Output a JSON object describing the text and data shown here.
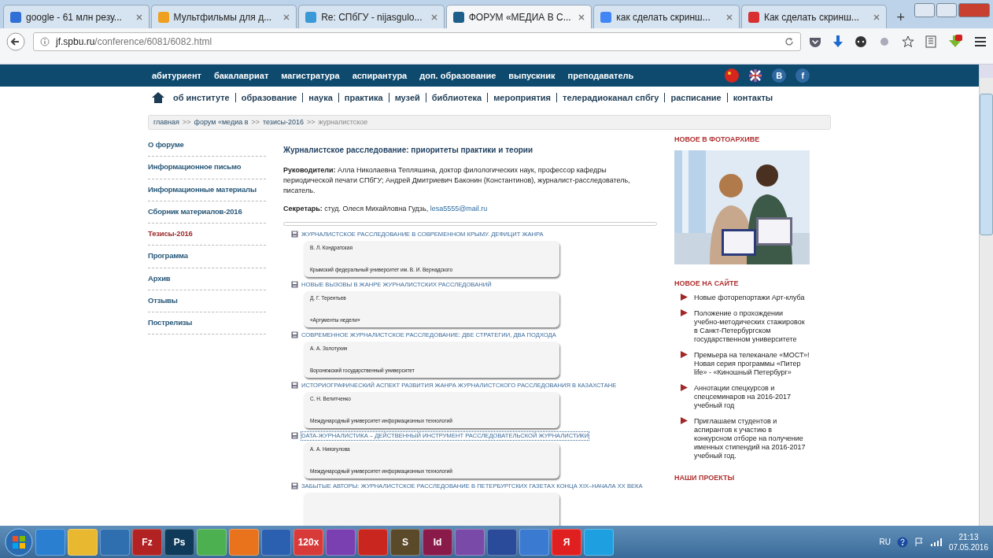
{
  "browser": {
    "tabs": [
      {
        "title": "google - 61 млн резу...",
        "selected": false,
        "color": "#2f6fd6"
      },
      {
        "title": "Мультфильмы для д...",
        "selected": false,
        "color": "#f0a020"
      },
      {
        "title": "Re: СПбГУ - nijasgulo...",
        "selected": false,
        "color": "#3a9ad8"
      },
      {
        "title": "ФОРУМ «МЕДИА В С...",
        "selected": true,
        "color": "#1d5f8a"
      },
      {
        "title": "как сделать скринш...",
        "selected": false,
        "color": "#4285f4"
      },
      {
        "title": "Как сделать скринш...",
        "selected": false,
        "color": "#d83030"
      }
    ],
    "new_tab": "+",
    "address": {
      "host": "jf.spbu.ru",
      "path": "/conference/6081/6082.html"
    }
  },
  "site": {
    "top_menu": [
      "абитуриент",
      "бакалавриат",
      "магистратура",
      "аспирантура",
      "доп. образование",
      "выпускник",
      "преподаватель"
    ],
    "social": [
      "B",
      "f"
    ],
    "nav": [
      "об институте",
      "образование",
      "наука",
      "практика",
      "музей",
      "библиотека",
      "мероприятия",
      "телерадиоканал спбгу",
      "расписание",
      "контакты"
    ],
    "breadcrumb": [
      {
        "kind": "link",
        "label": "главная"
      },
      {
        "kind": "sep",
        "label": ">>"
      },
      {
        "kind": "link",
        "label": "форум «медиа в"
      },
      {
        "kind": "sep",
        "label": ">>"
      },
      {
        "kind": "link",
        "label": "тезисы-2016"
      },
      {
        "kind": "sep",
        "label": ">>"
      },
      {
        "kind": "current",
        "label": "журналистское"
      }
    ],
    "sidebar": [
      {
        "label": "О форуме",
        "selected": false
      },
      {
        "label": "Информационное письмо",
        "selected": false
      },
      {
        "label": "Информационные материалы",
        "selected": false
      },
      {
        "label": "Сборник материалов-2016",
        "selected": false
      },
      {
        "label": "Тезисы-2016",
        "selected": true
      },
      {
        "label": "Программа",
        "selected": false
      },
      {
        "label": "Архив",
        "selected": false
      },
      {
        "label": "Отзывы",
        "selected": false
      },
      {
        "label": "Пострелизы",
        "selected": false
      }
    ],
    "article": {
      "title": "Журналистское расследование: приоритеты практики и теории",
      "leaders": "**Руководители:** Алла Николаевна Тепляшина, доктор филологических наук, профессор кафедры периодической печати СПбГУ; Андрей Дмитриевич Баконин (Константинов), журналист-расследователь, писатель.",
      "secretary": "**Секретарь:** студ. Олеся Михайловна Гудзь,",
      "email": "lesa5555@mail.ru"
    },
    "theses": [
      {
        "title": "ЖУРНАЛИСТСКОЕ РАССЛЕДОВАНИЕ В СОВРЕМЕННОМ КРЫМУ. ДЕФИЦИТ ЖАНРА",
        "author": "В. Л. Кондратская",
        "affiliation": "Крымский федеральный университет им. В. И. Вернадского",
        "focused": false
      },
      {
        "title": "НОВЫЕ ВЫЗОВЫ В ЖАНРЕ ЖУРНАЛИСТСКИХ РАССЛЕДОВАНИЙ",
        "author": "Д. Г. Терентьев",
        "affiliation": "«Аргументы недели»",
        "focused": false
      },
      {
        "title": "СОВРЕМЕННОЕ ЖУРНАЛИСТСКОЕ РАССЛЕДОВАНИЕ: ДВЕ СТРАТЕГИИ, ДВА ПОДХОДА",
        "author": "А. А. Золотухин",
        "affiliation": "Воронежский государственный университет",
        "focused": false
      },
      {
        "title": "ИСТОРИОГРАФИЧЕСКИЙ АСПЕКТ РАЗВИТИЯ ЖАНРА ЖУРНАЛИСТСКОГО РАССЛЕДОВАНИЯ В КАЗАХСТАНЕ",
        "author": "С. Н. Велитченко",
        "affiliation": "Международный университет информационных технологий",
        "focused": false
      },
      {
        "title": "DATA-ЖУРНАЛИСТИКА – ДЕЙСТВЕННЫЙ ИНСТРУМЕНТ РАССЛЕДОВАТЕЛЬСКОЙ ЖУРНАЛИСТИКИ",
        "author": "А. А. Ниязгулова",
        "affiliation": "Международный университет информационных технологий",
        "focused": true
      },
      {
        "title": "ЗАБЫТЫЕ АВТОРЫ: ЖУРНАЛИСТСКОЕ РАССЛЕДОВАНИЕ В ПЕТЕРБУРГСКИХ ГАЗЕТАХ КОНЦА XIX–НАЧАЛА XX ВЕКА",
        "focused": false
      }
    ],
    "right": {
      "photo_heading": "НОВОЕ В ФОТОАРХИВЕ",
      "photo": {
        "kind": "picture"
      },
      "news_heading": "НОВОЕ НА САЙТЕ",
      "news": [
        "Новые фоторепортажи Арт-клуба",
        "Положение о прохождении учебно-методических стажировок в Санкт-Петербургском государственном университете",
        "Премьера на телеканале «МОСТ»! Новая серия программы «Питер life» - «Киношный Петербург»",
        "Аннотации спецкурсов и спецсеминаров на 2016-2017 учебный год",
        "Приглашаем студентов и аспирантов к участию в конкурсном отборе на получение именных стипендий на 2016-2017 учебный год."
      ],
      "projects_heading": "НАШИ ПРОЕКТЫ"
    }
  },
  "taskbar": {
    "items": [
      {
        "color": "#2a7fd0"
      },
      {
        "color": "#e8b830"
      },
      {
        "color": "#2f6fb0"
      },
      {
        "label": "Fz",
        "color": "#b22222"
      },
      {
        "label": "Ps",
        "color": "#0f3a5a"
      },
      {
        "color": "#4caf50"
      },
      {
        "color": "#e8731c"
      },
      {
        "color": "#2b5fb0"
      },
      {
        "label": "120x",
        "color": "#d83a3a"
      },
      {
        "color": "#7a3fb0"
      },
      {
        "color": "#c8261e"
      },
      {
        "label": "S",
        "color": "#5a4a2a"
      },
      {
        "label": "Id",
        "color": "#8a1a4a"
      },
      {
        "color": "#7a4aa8"
      },
      {
        "color": "#2a4a9a"
      },
      {
        "color": "#3a7ad0"
      },
      {
        "label": "Я",
        "color": "#e02020"
      },
      {
        "color": "#1ea0e0"
      }
    ],
    "language": "RU",
    "time": "21:13",
    "date": "07.05.2016"
  }
}
